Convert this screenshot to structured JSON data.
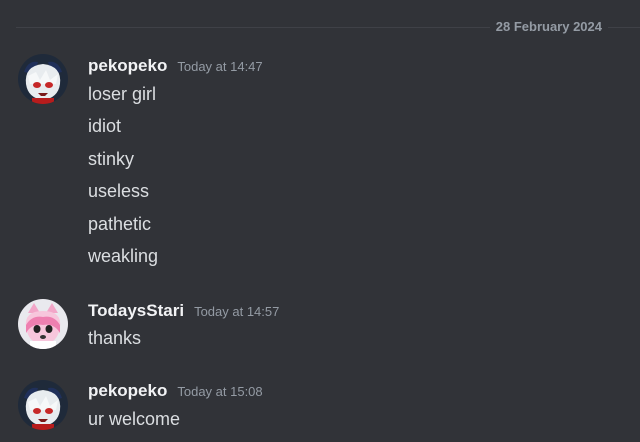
{
  "date_divider": "28 February 2024",
  "messages": [
    {
      "author": "pekopeko",
      "timestamp": "Today at 14:47",
      "lines": [
        "loser girl",
        "idiot",
        "stinky",
        "useless",
        "pathetic",
        "weakling"
      ]
    },
    {
      "author": "TodaysStari",
      "timestamp": "Today at 14:57",
      "lines": [
        "thanks"
      ]
    },
    {
      "author": "pekopeko",
      "timestamp": "Today at 15:08",
      "lines": [
        "ur welcome"
      ]
    }
  ],
  "colors": {
    "background": "#313338",
    "username": "#f2f3f5",
    "message_text": "#dbdee1",
    "timestamp": "#949ba4",
    "divider": "#3f4147"
  }
}
